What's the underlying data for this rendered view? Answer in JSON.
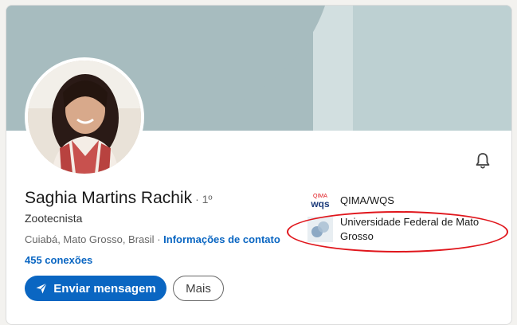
{
  "profile": {
    "name": "Saghia Martins Rachik",
    "degree": "· 1º",
    "headline": "Zootecnista",
    "location": "Cuiabá, Mato Grosso, Brasil",
    "separator": "·",
    "contact_link": "Informações de contato",
    "connections": "455 conexões"
  },
  "actions": {
    "message_label": "Enviar mensagem",
    "more_label": "Mais"
  },
  "experience": [
    {
      "logo_text_top": "QIMA",
      "logo_text_bottom": "wqs",
      "company": "QIMA/WQS"
    },
    {
      "company": "Universidade Federal de Mato Grosso"
    }
  ],
  "colors": {
    "primary": "#0a66c2",
    "highlight_annotation": "#e0161c",
    "banner": "#a7bcbf"
  },
  "icons": {
    "notification": "bell-icon",
    "message": "send-icon"
  }
}
